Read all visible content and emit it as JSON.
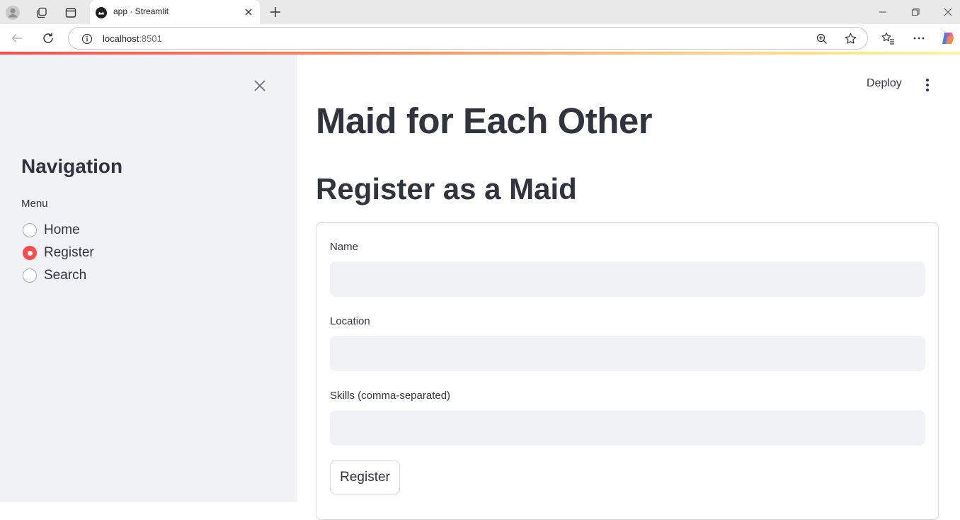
{
  "browser": {
    "tab_title": "app · Streamlit",
    "url_host": "localhost",
    "url_port": ":8501"
  },
  "sidebar": {
    "heading": "Navigation",
    "menu_label": "Menu",
    "items": [
      {
        "label": "Home",
        "selected": false
      },
      {
        "label": "Register",
        "selected": true
      },
      {
        "label": "Search",
        "selected": false
      }
    ]
  },
  "header": {
    "deploy_label": "Deploy"
  },
  "main": {
    "title": "Maid for Each Other",
    "subheader": "Register as a Maid",
    "form": {
      "fields": [
        {
          "label": "Name",
          "value": ""
        },
        {
          "label": "Location",
          "value": ""
        },
        {
          "label": "Skills (comma-separated)",
          "value": ""
        }
      ],
      "submit_label": "Register"
    }
  },
  "colors": {
    "accent": "#ff4b4b",
    "sidebar_bg": "#f0f2f6",
    "text": "#31333f",
    "input_bg": "#f0f2f6"
  }
}
